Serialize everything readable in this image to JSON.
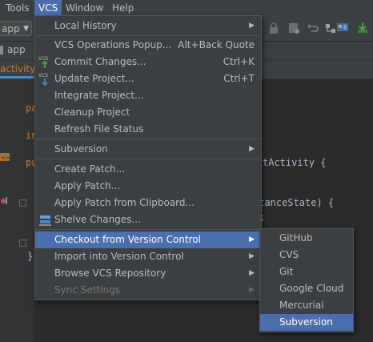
{
  "menubar": {
    "items": [
      "Tools",
      "VCS",
      "Window",
      "Help"
    ],
    "active": "VCS"
  },
  "toolbar": {
    "run_config": "app"
  },
  "navbar": {
    "crumb": "app"
  },
  "tabs": {
    "active_tab": "activity_"
  },
  "editor": {
    "lines": [
      "pa",
      "in",
      "pu",
      "tActivity {",
      "stanceState) {",
      ";",
      "}"
    ]
  },
  "vcs_menu": {
    "items": [
      {
        "label": "Local History",
        "submenu": true
      },
      {
        "label": "VCS Operations Popup...",
        "shortcut": "Alt+Back Quote"
      },
      {
        "label": "Commit Changes...",
        "shortcut": "Ctrl+K",
        "icon": "vcs-commit-icon"
      },
      {
        "label": "Update Project...",
        "shortcut": "Ctrl+T",
        "icon": "vcs-update-icon"
      },
      {
        "label": "Integrate Project..."
      },
      {
        "label": "Cleanup Project"
      },
      {
        "label": "Refresh File Status"
      },
      {
        "label": "Subversion",
        "submenu": true
      },
      {
        "label": "Create Patch..."
      },
      {
        "label": "Apply Patch..."
      },
      {
        "label": "Apply Patch from Clipboard..."
      },
      {
        "label": "Shelve Changes...",
        "icon": "shelve-icon"
      },
      {
        "label": "Checkout from Version Control",
        "submenu": true,
        "selected": true
      },
      {
        "label": "Import into Version Control",
        "submenu": true
      },
      {
        "label": "Browse VCS Repository",
        "submenu": true
      },
      {
        "label": "Sync Settings",
        "submenu": true,
        "disabled": true
      }
    ]
  },
  "checkout_submenu": {
    "items": [
      "GitHub",
      "CVS",
      "Git",
      "Google Cloud",
      "Mercurial",
      "Subversion"
    ],
    "selected": "Subversion"
  },
  "colors": {
    "menu_bg": "#3c3f41",
    "selection": "#4b6eaf",
    "editor_bg": "#2b2b2b"
  }
}
